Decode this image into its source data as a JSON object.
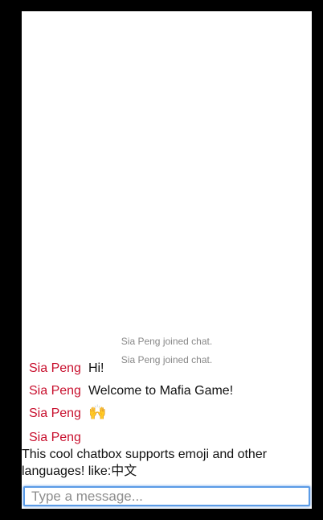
{
  "chat": {
    "system_messages": [
      "Sia Peng joined chat.",
      "Sia Peng joined chat."
    ],
    "messages": [
      {
        "user": "Sia Peng",
        "text": "Hi!"
      },
      {
        "user": "Sia Peng",
        "text": "Welcome to Mafia Game!"
      },
      {
        "user": "Sia Peng",
        "text": "🙌"
      },
      {
        "user": "Sia Peng",
        "text": "This cool chatbox supports emoji and other languages! like:中文"
      }
    ]
  },
  "input": {
    "placeholder": "Type a message...",
    "value": ""
  },
  "colors": {
    "username": "#c8102e",
    "system_text": "#888888",
    "input_focus_border": "#5b9be6",
    "frame": "#000000"
  }
}
